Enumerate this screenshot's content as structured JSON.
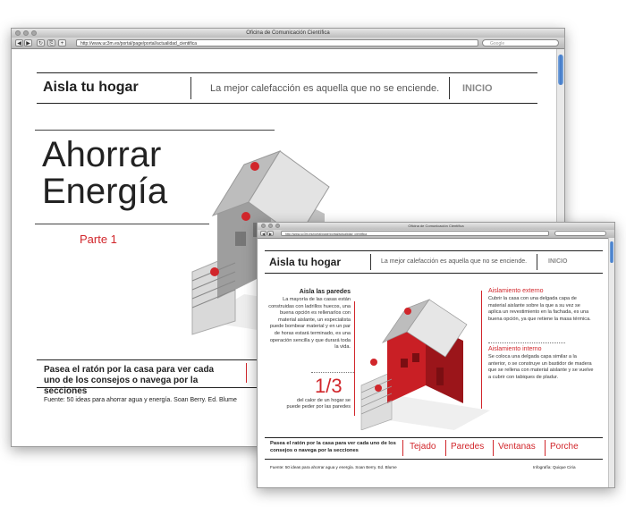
{
  "back": {
    "window_title": "Oficina de Comunicación Científica",
    "url": "http://www.uc3m.es/portal/page/portal/actualidad_cientifica",
    "search_placeholder": "Google",
    "header": {
      "title": "Aisla tu hogar",
      "tagline": "La mejor calefacción es aquella que no se enciende.",
      "inicio": "INICIO"
    },
    "headline_line1": "Ahorrar",
    "headline_line2": "Energía",
    "part": "Parte 1",
    "instructions": "Pasea el ratón por la casa para ver cada uno de los consejos o navega por la secciones",
    "source": "Fuente: 50 ideas para ahorrar agua y energía. Soan Berry. Ed. Blume"
  },
  "front": {
    "window_title": "Oficina de Comunicación Científica",
    "url": "http://www.uc3m.es/portal/page/portal/actualidad_cientifica",
    "header": {
      "title": "Aisla tu hogar",
      "tagline": "La mejor calefacción es aquella que no se enciende.",
      "inicio": "INICIO"
    },
    "walls": {
      "title": "Aisla las paredes",
      "text": "La mayoría de las casas están construidas con ladrillos huecos, una buena opción es rellenarlos con material aislante, un especialista puede bombear material y en un par de horas estará terminado, es una operación sencilla y que durará toda la vida."
    },
    "stat": {
      "value": "1/3",
      "text": "del calor de un hogar se puede peder por las paredes"
    },
    "external": {
      "title": "Aislamiento externo",
      "text": "Cubrir la casa con una delgada capa de material aislante sobre la que a su vez se aplica un revestimiento en la fachada, es una buena opción, ya que retiene la masa térmica."
    },
    "internal": {
      "title": "Aislamiento interno",
      "text": "Se coloca una delgada capa similar a la anterior, o se construye un bastidor de madera que se rellena con material aislante y se vuelve a cubrir con tabiques de pladur."
    },
    "instructions": "Pasea el ratón por la casa para ver cada uno de los consejos o navega por la secciones",
    "nav": [
      "Tejado",
      "Paredes",
      "Ventanas",
      "Porche"
    ],
    "source": "Fuente: 50 ideas para ahorrar agua y energía. Soan Berry. Ed. Blume",
    "credit": "Infografía: Quique Ciria"
  },
  "colors": {
    "accent": "#d1262b",
    "text": "#222222",
    "muted": "#8a8a8a"
  }
}
